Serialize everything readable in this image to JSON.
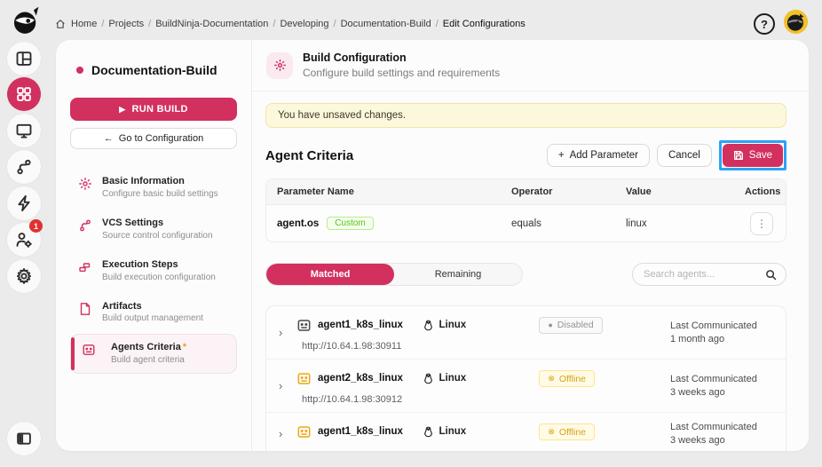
{
  "icons": {
    "play": "▶",
    "arrow_left": "←",
    "plus": "+",
    "question": "?",
    "dots_vertical": "⋮",
    "chevron_right": "›",
    "dot": "●",
    "disconnect": "⊗"
  },
  "topbar": {
    "breadcrumb": {
      "separator": "/",
      "items": [
        "Home",
        "Projects",
        "BuildNinja-Documentation",
        "Developing",
        "Documentation-Build",
        "Edit Configurations"
      ]
    }
  },
  "rail": {
    "notification_badge": "1"
  },
  "sidebar": {
    "project": "Documentation-Build",
    "run_label": "RUN BUILD",
    "goto_label": "Go to Configuration",
    "items": [
      {
        "title": "Basic Information",
        "subtitle": "Configure basic build settings"
      },
      {
        "title": "VCS Settings",
        "subtitle": "Source control configuration"
      },
      {
        "title": "Execution Steps",
        "subtitle": "Build execution configuration"
      },
      {
        "title": "Artifacts",
        "subtitle": "Build output management"
      },
      {
        "title": "Agents Criteria",
        "required_mark": "*",
        "subtitle": "Build agent criteria"
      }
    ]
  },
  "main": {
    "header": {
      "title": "Build Configuration",
      "subtitle": "Configure build settings and requirements"
    },
    "alert": "You have unsaved changes.",
    "section_title": "Agent Criteria",
    "buttons": {
      "add_parameter": "Add Parameter",
      "cancel": "Cancel",
      "save": "Save"
    },
    "table": {
      "headers": [
        "Parameter Name",
        "Operator",
        "Value",
        "Actions"
      ],
      "row": {
        "name": "agent.os",
        "tag": "Custom",
        "operator": "equals",
        "value": "linux"
      }
    },
    "tabs": {
      "matched": "Matched",
      "remaining": "Remaining"
    },
    "search_placeholder": "Search agents...",
    "agents": [
      {
        "name": "agent1_k8s_linux",
        "os": "Linux",
        "status": "Disabled",
        "last_label": "Last Communicated",
        "last_value": "1 month ago",
        "url": "http://10.64.1.98:30911"
      },
      {
        "name": "agent2_k8s_linux",
        "os": "Linux",
        "status": "Offline",
        "last_label": "Last Communicated",
        "last_value": "3 weeks ago",
        "url": "http://10.64.1.98:30912"
      },
      {
        "name": "agent1_k8s_linux",
        "os": "Linux",
        "status": "Offline",
        "last_label": "Last Communicated",
        "last_value": "3 weeks ago",
        "url": ""
      }
    ],
    "accent_color": "#d2305f",
    "highlight_color": "#2ba2f6"
  }
}
